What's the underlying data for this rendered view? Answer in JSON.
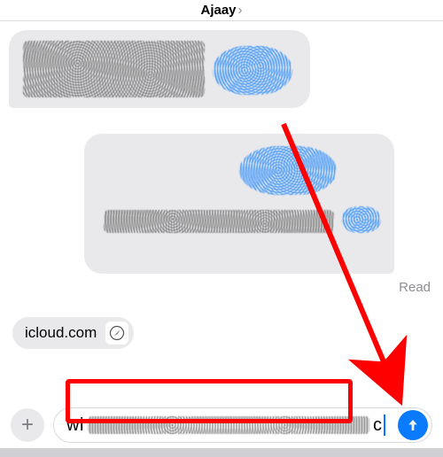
{
  "header": {
    "contact_name": "Ajaay"
  },
  "messages": {
    "read_receipt": "Read"
  },
  "suggestion": {
    "text": "icloud.com",
    "icon": "safari-icon"
  },
  "compose": {
    "plus_label": "+",
    "input_prefix": "wi",
    "input_suffix": "c"
  },
  "colors": {
    "accent": "#0a7aff",
    "bubble": "#e9e9eb",
    "annotation": "#ff0000"
  }
}
